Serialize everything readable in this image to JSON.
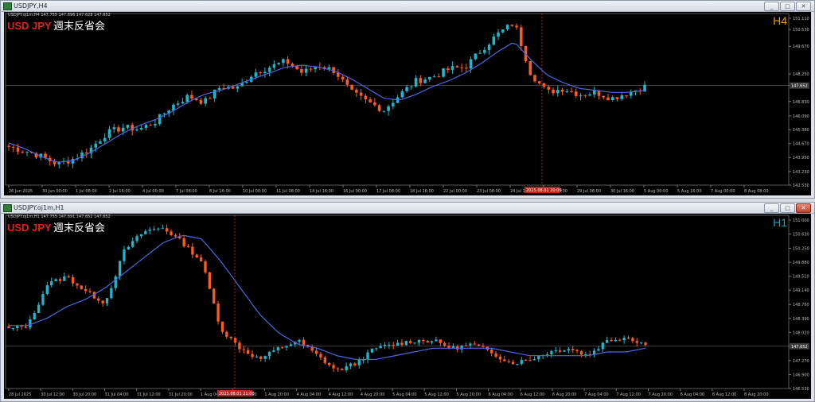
{
  "window_top": {
    "title": "USDJPY,H4",
    "controls": [
      "_",
      "□",
      "✕"
    ],
    "info_line": "USDJPY.oj1m,H4   147.755 147.896 147.628 147.652",
    "symbol_label": "USD JPY",
    "caption_label": "週末反省会",
    "timeframe_label": "H4",
    "current_price_label": "147.652",
    "cursor_date_label": "2025.08.01 20:00",
    "colors": {
      "up": "#1fb7c9",
      "down": "#ff5a1f",
      "ma": "#4f66e0",
      "timeframe": "#e69a12",
      "symbol": "#e0231a"
    },
    "chart_data": {
      "type": "candlestick",
      "timeframe": "H4",
      "y_ticks": [
        "151.110",
        "150.530",
        "149.670",
        "148.250",
        "147.652",
        "146.830",
        "146.090",
        "145.380",
        "144.670",
        "143.950",
        "143.230",
        "142.530"
      ],
      "ylim": [
        142.53,
        151.11
      ],
      "x_ticks": [
        "26 Jun 2025",
        "30 Jun 00:00",
        "1 Jul 08:00",
        "2 Jul 16:00",
        "4 Jul 00:00",
        "7 Jul 08:00",
        "8 Jul 16:00",
        "10 Jul 00:00",
        "11 Jul 08:00",
        "14 Jul 16:00",
        "16 Jul 00:00",
        "17 Jul 08:00",
        "18 Jul 16:00",
        "22 Jul 00:00",
        "23 Jul 08:00",
        "24 Jul 16:00",
        "28 Jul 00:00",
        "29 Jul 08:00",
        "30 Jul 16:00",
        "5 Aug 00:00",
        "5 Aug 16:00",
        "7 Aug 00:00",
        "8 Aug 08:00"
      ],
      "close_path": [
        144.5,
        144.3,
        144.0,
        143.6,
        143.9,
        144.4,
        145.2,
        145.5,
        145.4,
        145.8,
        146.6,
        147.1,
        146.8,
        147.6,
        147.5,
        148.3,
        148.6,
        148.9,
        148.3,
        148.7,
        148.4,
        147.3,
        146.8,
        146.4,
        147.2,
        147.9,
        148.1,
        148.5,
        148.6,
        149.5,
        150.3,
        150.9,
        148.3,
        147.3,
        147.5,
        147.2,
        147.3,
        147.0,
        147.3,
        147.6
      ],
      "ma_path": [
        144.7,
        144.4,
        144.0,
        143.7,
        143.8,
        144.2,
        144.7,
        145.2,
        145.6,
        145.9,
        146.3,
        146.8,
        147.2,
        147.4,
        147.7,
        148.0,
        148.3,
        148.6,
        148.7,
        148.6,
        148.4,
        148.0,
        147.5,
        147.0,
        146.9,
        147.2,
        147.6,
        147.9,
        148.3,
        148.8,
        149.4,
        149.9,
        149.0,
        148.2,
        147.8,
        147.5,
        147.4,
        147.3,
        147.3,
        147.4
      ]
    }
  },
  "window_bottom": {
    "title": "USDJPY.oj1m,H1",
    "controls": [
      "_",
      "□",
      "✕"
    ],
    "info_line": "USDJPY.oj1m,H1   147.755 147.891 147.652 147.652",
    "symbol_label": "USD JPY",
    "caption_label": "週末反省会",
    "timeframe_label": "H1",
    "current_price_label": "147.652",
    "cursor_date_label": "2025.08.01 21:00",
    "colors": {
      "up": "#1fb7c9",
      "down": "#ff5a1f",
      "ma": "#4f66e0",
      "timeframe": "#17a7b8",
      "symbol": "#e0231a"
    },
    "chart_data": {
      "type": "candlestick",
      "timeframe": "H1",
      "y_ticks": [
        "151.000",
        "150.630",
        "150.250",
        "149.880",
        "149.510",
        "149.140",
        "148.760",
        "148.390",
        "148.020",
        "147.652",
        "147.270",
        "146.900",
        "146.530"
      ],
      "ylim": [
        146.53,
        151.0
      ],
      "x_ticks": [
        "28 Jul 2025",
        "30 Jul 12:00",
        "30 Jul 20:00",
        "31 Jul 04:00",
        "31 Jul 12:00",
        "31 Jul 20:00",
        "1 Aug 04:00",
        "1 Aug 12:00",
        "1 Aug 20:00",
        "4 Aug 04:00",
        "4 Aug 12:00",
        "4 Aug 20:00",
        "5 Aug 04:00",
        "5 Aug 12:00",
        "5 Aug 20:00",
        "6 Aug 04:00",
        "6 Aug 12:00",
        "6 Aug 20:00",
        "7 Aug 04:00",
        "7 Aug 12:00",
        "7 Aug 20:00",
        "8 Aug 04:00",
        "8 Aug 12:00",
        "8 Aug 20:00"
      ],
      "close_path": [
        148.1,
        148.2,
        149.3,
        149.5,
        149.1,
        148.8,
        150.2,
        150.7,
        150.8,
        150.4,
        149.9,
        148.1,
        147.6,
        147.3,
        147.6,
        147.8,
        147.4,
        147.0,
        147.2,
        147.6,
        147.7,
        147.8,
        147.8,
        147.6,
        147.7,
        147.5,
        147.2,
        147.3,
        147.5,
        147.6,
        147.4,
        147.8,
        147.9,
        147.7
      ],
      "ma_path": [
        148.2,
        148.2,
        148.4,
        148.7,
        148.9,
        149.2,
        149.6,
        150.0,
        150.4,
        150.6,
        150.5,
        149.9,
        149.2,
        148.5,
        148.0,
        147.7,
        147.6,
        147.4,
        147.3,
        147.3,
        147.4,
        147.5,
        147.6,
        147.6,
        147.6,
        147.6,
        147.5,
        147.4,
        147.4,
        147.4,
        147.4,
        147.5,
        147.5,
        147.6
      ]
    }
  }
}
